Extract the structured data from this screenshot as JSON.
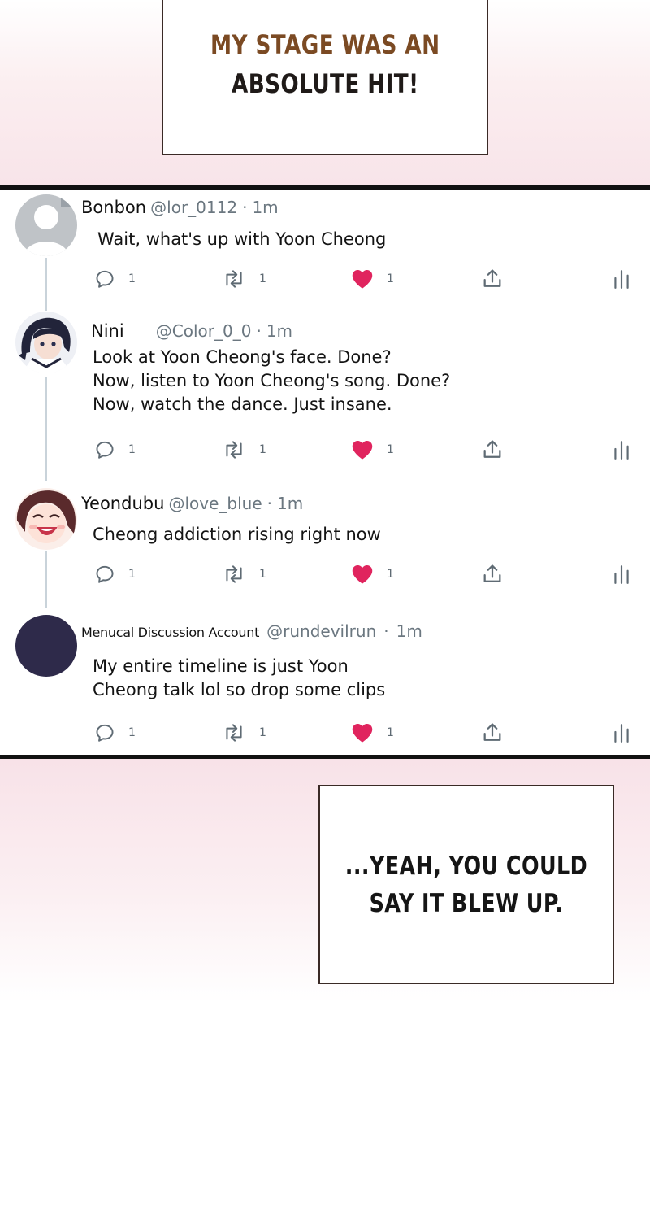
{
  "captions": {
    "top": {
      "line1": "MY STAGE WAS AN",
      "line2": "ABSOLUTE HIT!"
    },
    "bottom": {
      "line1": "...YEAH, YOU COULD",
      "line2": "SAY IT BLEW UP."
    }
  },
  "tweets": [
    {
      "name": "Bonbon",
      "handle": "@lor_0112",
      "separator": "·",
      "time": "1m",
      "body": "Wait, what's up with Yoon Cheong",
      "avatar": "default-profile",
      "replies": "1",
      "retweets": "1",
      "likes": "1"
    },
    {
      "name": "Nini",
      "handle": "@Color_0_0",
      "separator": "·",
      "time": "1m",
      "body": "Look at Yoon Cheong's face. Done?\nNow, listen to Yoon Cheong's song. Done?\nNow, watch the dance. Just insane.",
      "avatar": "character-dark-hair",
      "replies": "1",
      "retweets": "1",
      "likes": "1"
    },
    {
      "name": "Yeondubu",
      "handle": "@love_blue",
      "separator": "·",
      "time": "1m",
      "body": "Cheong addiction rising right now",
      "avatar": "character-laughing",
      "replies": "1",
      "retweets": "1",
      "likes": "1"
    },
    {
      "name": "Menucal Discussion Account",
      "handle": "@rundevilrun",
      "separator": "·",
      "time": "1m",
      "body": "My entire timeline is just Yoon\nCheong talk lol so drop some clips",
      "avatar": "solid-navy",
      "replies": "1",
      "retweets": "1",
      "likes": "1"
    }
  ],
  "icons": {
    "reply": "reply-icon",
    "retweet": "retweet-icon",
    "like": "heart-icon",
    "share": "share-icon",
    "stats": "analytics-icon"
  },
  "colors": {
    "like": "#e0245e",
    "icon": "#5f6b74",
    "caption_top_line1": "#7b4a23",
    "border": "#111111",
    "avatar_navy": "#2e2a4a"
  }
}
